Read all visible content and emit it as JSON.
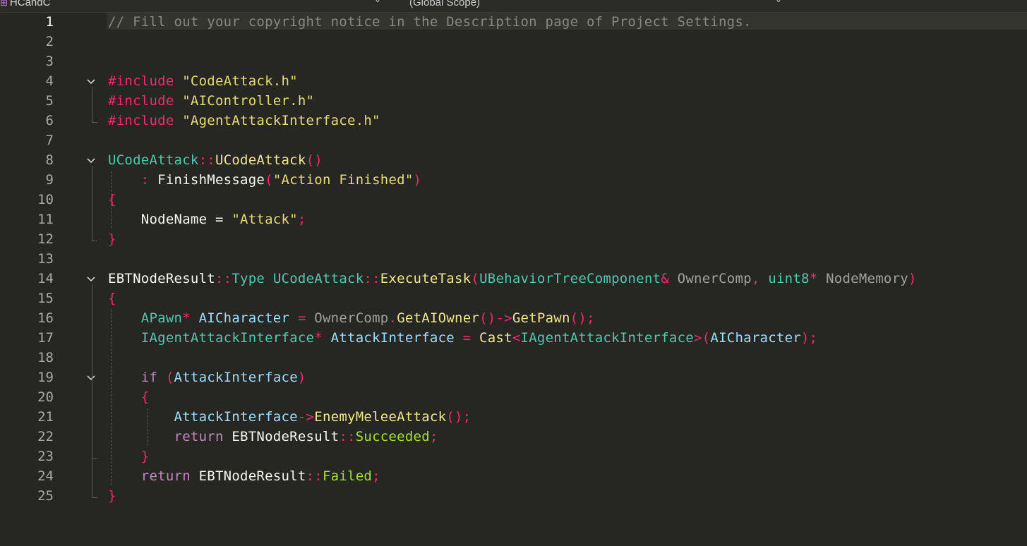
{
  "topbar": {
    "project": "HCandC",
    "scope": "(Global Scope)",
    "project_dropdown_icon": "chevron-down-icon",
    "scope_dropdown_icon": "chevron-down-icon"
  },
  "editor": {
    "current_line": 1,
    "line_numbers": [
      "1",
      "2",
      "3",
      "4",
      "5",
      "6",
      "7",
      "8",
      "9",
      "10",
      "11",
      "12",
      "13",
      "14",
      "15",
      "16",
      "17",
      "18",
      "19",
      "20",
      "21",
      "22",
      "23",
      "24",
      "25"
    ],
    "lines": [
      [
        {
          "t": "// Fill out your copyright notice in the Description page of Project Settings.",
          "c": "cm"
        }
      ],
      [],
      [],
      [
        {
          "t": "#include ",
          "c": "pp"
        },
        {
          "t": "\"CodeAttack.h\"",
          "c": "str"
        }
      ],
      [
        {
          "t": "#include ",
          "c": "pp"
        },
        {
          "t": "\"AIController.h\"",
          "c": "str"
        }
      ],
      [
        {
          "t": "#include ",
          "c": "pp"
        },
        {
          "t": "\"AgentAttackInterface.h\"",
          "c": "str"
        }
      ],
      [],
      [
        {
          "t": "UCodeAttack",
          "c": "cls"
        },
        {
          "t": "::",
          "c": "op"
        },
        {
          "t": "UCodeAttack",
          "c": "fn"
        },
        {
          "t": "()",
          "c": "op"
        }
      ],
      [
        {
          "t": "    ",
          "c": "id"
        },
        {
          "t": ": ",
          "c": "op"
        },
        {
          "t": "FinishMessage",
          "c": "id"
        },
        {
          "t": "(",
          "c": "op"
        },
        {
          "t": "\"Action Finished\"",
          "c": "str"
        },
        {
          "t": ")",
          "c": "op"
        }
      ],
      [
        {
          "t": "{",
          "c": "op"
        }
      ],
      [
        {
          "t": "    NodeName ",
          "c": "id"
        },
        {
          "t": "= ",
          "c": "id"
        },
        {
          "t": "\"Attack\"",
          "c": "str"
        },
        {
          "t": ";",
          "c": "op"
        }
      ],
      [
        {
          "t": "}",
          "c": "op"
        }
      ],
      [],
      [
        {
          "t": "EBTNodeResult",
          "c": "id"
        },
        {
          "t": "::",
          "c": "op"
        },
        {
          "t": "Type ",
          "c": "cls"
        },
        {
          "t": "UCodeAttack",
          "c": "cls"
        },
        {
          "t": "::",
          "c": "op"
        },
        {
          "t": "ExecuteTask",
          "c": "fn"
        },
        {
          "t": "(",
          "c": "op"
        },
        {
          "t": "UBehaviorTreeComponent",
          "c": "cls"
        },
        {
          "t": "& ",
          "c": "op"
        },
        {
          "t": "OwnerComp",
          "c": "par"
        },
        {
          "t": ", ",
          "c": "op"
        },
        {
          "t": "uint8",
          "c": "cls"
        },
        {
          "t": "* ",
          "c": "op"
        },
        {
          "t": "NodeMemory",
          "c": "par"
        },
        {
          "t": ")",
          "c": "op"
        }
      ],
      [
        {
          "t": "{",
          "c": "op"
        }
      ],
      [
        {
          "t": "    ",
          "c": "id"
        },
        {
          "t": "APawn",
          "c": "cls"
        },
        {
          "t": "* ",
          "c": "op"
        },
        {
          "t": "AICharacter ",
          "c": "var"
        },
        {
          "t": "= ",
          "c": "op"
        },
        {
          "t": "OwnerComp",
          "c": "par"
        },
        {
          "t": ".",
          "c": "op"
        },
        {
          "t": "GetAIOwner",
          "c": "fn"
        },
        {
          "t": "()->",
          "c": "op"
        },
        {
          "t": "GetPawn",
          "c": "fn"
        },
        {
          "t": "();",
          "c": "op"
        }
      ],
      [
        {
          "t": "    ",
          "c": "id"
        },
        {
          "t": "IAgentAttackInterface",
          "c": "cls"
        },
        {
          "t": "* ",
          "c": "op"
        },
        {
          "t": "AttackInterface ",
          "c": "var"
        },
        {
          "t": "= ",
          "c": "op"
        },
        {
          "t": "Cast",
          "c": "fn"
        },
        {
          "t": "<",
          "c": "op"
        },
        {
          "t": "IAgentAttackInterface",
          "c": "cls"
        },
        {
          "t": ">(",
          "c": "op"
        },
        {
          "t": "AICharacter",
          "c": "var"
        },
        {
          "t": ");",
          "c": "op"
        }
      ],
      [],
      [
        {
          "t": "    ",
          "c": "id"
        },
        {
          "t": "if ",
          "c": "kw"
        },
        {
          "t": "(",
          "c": "op"
        },
        {
          "t": "AttackInterface",
          "c": "var"
        },
        {
          "t": ")",
          "c": "op"
        }
      ],
      [
        {
          "t": "    ",
          "c": "id"
        },
        {
          "t": "{",
          "c": "op"
        }
      ],
      [
        {
          "t": "        ",
          "c": "id"
        },
        {
          "t": "AttackInterface",
          "c": "var"
        },
        {
          "t": "->",
          "c": "op"
        },
        {
          "t": "EnemyMeleeAttack",
          "c": "fn"
        },
        {
          "t": "();",
          "c": "op"
        }
      ],
      [
        {
          "t": "        ",
          "c": "id"
        },
        {
          "t": "return ",
          "c": "kw"
        },
        {
          "t": "EBTNodeResult",
          "c": "id"
        },
        {
          "t": "::",
          "c": "op"
        },
        {
          "t": "Succeeded",
          "c": "en"
        },
        {
          "t": ";",
          "c": "op"
        }
      ],
      [
        {
          "t": "    ",
          "c": "id"
        },
        {
          "t": "}",
          "c": "op"
        }
      ],
      [
        {
          "t": "    ",
          "c": "id"
        },
        {
          "t": "return ",
          "c": "kw"
        },
        {
          "t": "EBTNodeResult",
          "c": "id"
        },
        {
          "t": "::",
          "c": "op"
        },
        {
          "t": "Failed",
          "c": "en"
        },
        {
          "t": ";",
          "c": "op"
        }
      ],
      [
        {
          "t": "}",
          "c": "op"
        }
      ]
    ],
    "fold_lines": [
      4,
      8,
      14,
      19
    ],
    "fold_icon": "chevron-down-icon"
  },
  "colors": {
    "background": "#262622",
    "comment": "#888880",
    "preprocessor": "#f92672",
    "string": "#e6db74",
    "type": "#4ec9b0",
    "function": "#f0e68c",
    "keyword": "#c586c0",
    "variable": "#9cdcfe",
    "enum": "#a6e22e"
  }
}
